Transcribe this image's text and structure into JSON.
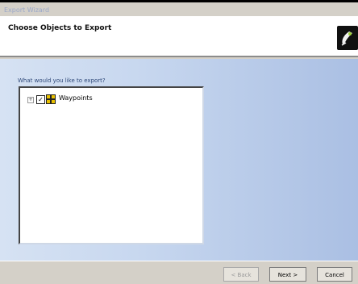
{
  "window": {
    "title": "Export Wizard"
  },
  "header": {
    "title": "Choose Objects to Export",
    "logo_icon": "pen-logo-icon"
  },
  "main": {
    "prompt": "What would you like to export?",
    "tree": [
      {
        "label": "Waypoints",
        "checked": true,
        "expanded": false,
        "icon": "waypoint-icon"
      }
    ]
  },
  "footer": {
    "back_label": "< Back",
    "next_label": "Next >",
    "cancel_label": "Cancel"
  }
}
